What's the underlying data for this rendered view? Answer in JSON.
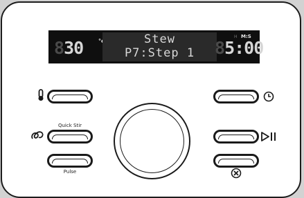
{
  "display": {
    "temp_ghost": "8",
    "temp_value": "30",
    "temp_unit": "°c",
    "program_name": "Stew",
    "program_step": "P7:Step 1",
    "timer_ghost": "8",
    "timer_value": "5:00",
    "timer_h": "H",
    "timer_ms": "M:S"
  },
  "buttons": {
    "quick_stir_label": "Quick Stir",
    "pulse_label": "Pulse"
  },
  "icons": {
    "temperature": "thermometer-icon",
    "stir": "stir-icon",
    "timer": "clock-icon",
    "start_pause": "play-pause-icon",
    "cancel": "cancel-icon"
  }
}
